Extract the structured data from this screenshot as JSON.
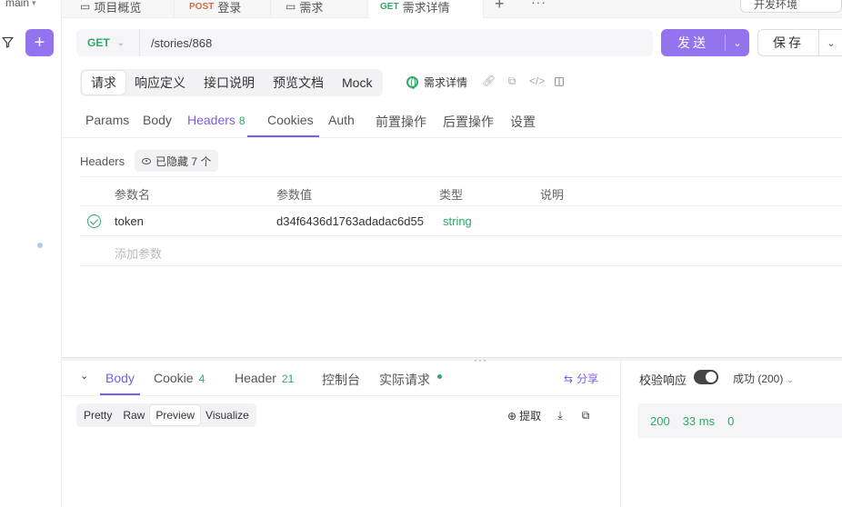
{
  "sidebar": {
    "branch": "main",
    "add_label": "+"
  },
  "tabs": [
    {
      "method": "",
      "label": "项目概览"
    },
    {
      "method": "POST",
      "label": "登录"
    },
    {
      "method": "",
      "label": "需求"
    },
    {
      "method": "GET",
      "label": "需求详情"
    }
  ],
  "environment": "开发环境",
  "request": {
    "method": "GET",
    "url": "/stories/868",
    "send_label": "发送",
    "save_label": "保存"
  },
  "sections": [
    "请求",
    "响应定义",
    "接口说明",
    "预览文档",
    "Mock"
  ],
  "request_name": "需求详情",
  "param_tabs": [
    {
      "label": "Params",
      "count": ""
    },
    {
      "label": "Body",
      "count": ""
    },
    {
      "label": "Headers",
      "count": "8"
    },
    {
      "label": "Cookies",
      "count": ""
    },
    {
      "label": "Auth",
      "count": ""
    },
    {
      "label": "前置操作",
      "count": ""
    },
    {
      "label": "后置操作",
      "count": ""
    },
    {
      "label": "设置",
      "count": ""
    }
  ],
  "headers": {
    "title": "Headers",
    "hidden_badge": "已隐藏 7 个",
    "columns": [
      "参数名",
      "参数值",
      "类型",
      "说明"
    ],
    "rows": [
      {
        "name": "token",
        "value": "d34f6436d1763adadac6d55",
        "type": "string",
        "desc": ""
      }
    ],
    "add_placeholder": "添加参数"
  },
  "response": {
    "tabs": [
      {
        "label": "Body",
        "count": ""
      },
      {
        "label": "Cookie",
        "count": "4"
      },
      {
        "label": "Header",
        "count": "21"
      },
      {
        "label": "控制台",
        "count": ""
      },
      {
        "label": "实际请求",
        "count": ""
      }
    ],
    "share_label": "分享",
    "view_modes": [
      "Pretty",
      "Raw",
      "Preview",
      "Visualize"
    ],
    "extract_label": "提取",
    "validate_label": "校验响应",
    "validate_on": true,
    "success_label": "成功 (200)",
    "status_code": "200",
    "time": "33 ms",
    "size": "0"
  },
  "colors": {
    "accent": "#9373ee",
    "success": "#2fa86a"
  }
}
